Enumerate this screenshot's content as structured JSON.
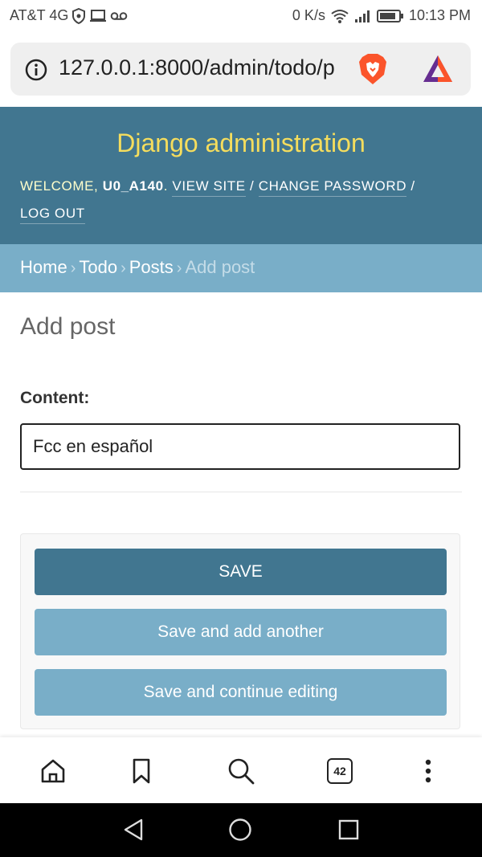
{
  "status_bar": {
    "carrier": "AT&T 4G",
    "net_speed": "0 K/s",
    "time": "10:13 PM"
  },
  "browser": {
    "url": "127.0.0.1:8000/admin/todo/p",
    "tab_count": "42"
  },
  "header": {
    "branding": "Django administration",
    "welcome": "WELCOME, ",
    "username": "U0_A140",
    "period": ". ",
    "view_site": "VIEW SITE",
    "sep1": " / ",
    "change_password": "CHANGE PASSWORD",
    "sep2": " / ",
    "log_out": "LOG OUT"
  },
  "breadcrumbs": {
    "home": "Home",
    "todo": "Todo",
    "posts": "Posts",
    "current": "Add post",
    "separator": "›"
  },
  "form": {
    "title": "Add post",
    "content_label": "Content:",
    "content_value": "Fcc en español"
  },
  "submit": {
    "save": "SAVE",
    "save_add_another": "Save and add another",
    "save_continue": "Save and continue editing"
  },
  "colors": {
    "header_bg": "#417690",
    "branding": "#f5dd5d",
    "breadcrumbs_bg": "#79aec8",
    "save_button": "#417690",
    "secondary_button": "#79aec8"
  },
  "icons": [
    "shield-icon",
    "laptop-icon",
    "voicemail-icon",
    "wifi-icon",
    "signal-icon",
    "battery-icon",
    "info-icon",
    "brave-lion-icon",
    "brave-rewards-icon",
    "home-icon",
    "bookmark-icon",
    "search-icon",
    "more-icon",
    "back-icon",
    "home-circle-icon",
    "recents-icon"
  ]
}
